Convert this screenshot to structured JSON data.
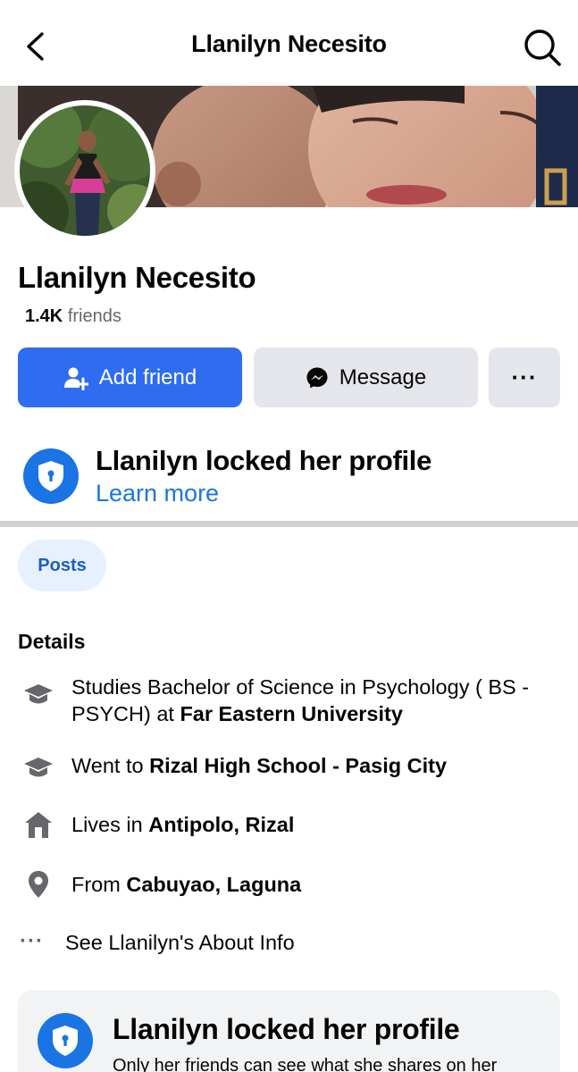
{
  "header": {
    "title": "Llanilyn Necesito",
    "back_icon": "chevron-left-icon",
    "search_icon": "search-icon"
  },
  "profile": {
    "name": "Llanilyn Necesito",
    "friends_count": "1.4K",
    "friends_label": "friends"
  },
  "actions": {
    "add_friend": "Add friend",
    "message": "Message",
    "more": "···"
  },
  "lock_banner": {
    "title": "Llanilyn locked her profile",
    "link": "Learn more"
  },
  "tabs": {
    "posts": "Posts"
  },
  "details": {
    "title": "Details",
    "items": [
      {
        "icon": "graduation-cap-icon",
        "prefix": "Studies Bachelor of Science in Psychology ( BS - PSYCH) at ",
        "bold": "Far Eastern University"
      },
      {
        "icon": "graduation-cap-icon",
        "prefix": "Went to ",
        "bold": "Rizal High School - Pasig City"
      },
      {
        "icon": "home-icon",
        "prefix": "Lives in ",
        "bold": "Antipolo, Rizal"
      },
      {
        "icon": "location-pin-icon",
        "prefix": "From ",
        "bold": "Cabuyao, Laguna"
      }
    ],
    "see_about": "See Llanilyn's About Info"
  },
  "lock_card": {
    "title": "Llanilyn locked her profile",
    "description": "Only her friends can see what she shares on her"
  },
  "colors": {
    "primary": "#2e6cf0",
    "link": "#1b74e4",
    "secondary_button": "#e4e6eb",
    "pill_bg": "#e7f0fd",
    "divider": "#ced0d4"
  }
}
